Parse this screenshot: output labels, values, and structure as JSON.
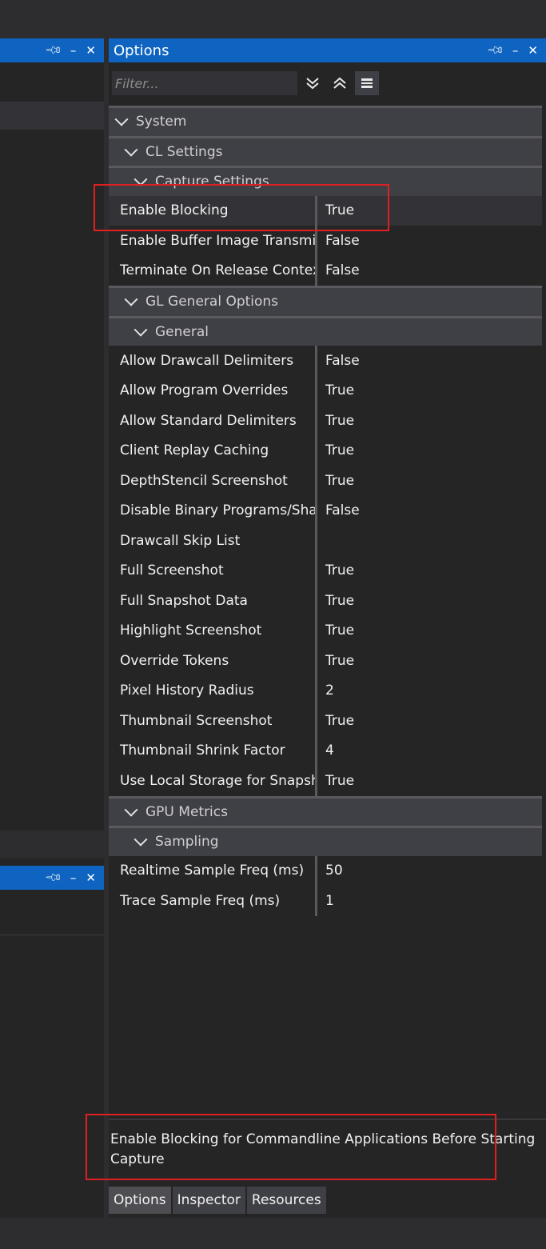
{
  "left_title_bar": {
    "icons": [
      "pin-icon",
      "minimize-icon",
      "close-icon"
    ]
  },
  "options": {
    "title": "Options",
    "filter_placeholder": "Filter...",
    "toolbar_icons": [
      "expand-all-icon",
      "collapse-all-icon",
      "categorize-icon"
    ]
  },
  "grid": {
    "system": "System",
    "cl_settings": "CL Settings",
    "capture_settings": "Capture Settings",
    "cl_rows": [
      {
        "name": "Enable Blocking",
        "value": "True"
      },
      {
        "name": "Enable Buffer Image Transmis",
        "value": "False"
      },
      {
        "name": "Terminate On Release Contex",
        "value": "False"
      }
    ],
    "gl_general_options": "GL General Options",
    "general": "General",
    "gl_rows": [
      {
        "name": "Allow Drawcall Delimiters",
        "value": "False"
      },
      {
        "name": "Allow Program Overrides",
        "value": "True"
      },
      {
        "name": "Allow Standard Delimiters",
        "value": "True"
      },
      {
        "name": "Client Replay Caching",
        "value": "True"
      },
      {
        "name": "DepthStencil Screenshot",
        "value": "True"
      },
      {
        "name": "Disable Binary Programs/Shad",
        "value": "False"
      },
      {
        "name": "Drawcall Skip List",
        "value": ""
      },
      {
        "name": "Full Screenshot",
        "value": "True"
      },
      {
        "name": "Full Snapshot Data",
        "value": "True"
      },
      {
        "name": "Highlight Screenshot",
        "value": "True"
      },
      {
        "name": "Override Tokens",
        "value": "True"
      },
      {
        "name": "Pixel History Radius",
        "value": "2"
      },
      {
        "name": "Thumbnail Screenshot",
        "value": "True"
      },
      {
        "name": "Thumbnail Shrink Factor",
        "value": "4"
      },
      {
        "name": "Use Local Storage for Snapsh",
        "value": "True"
      }
    ],
    "gpu_metrics": "GPU Metrics",
    "sampling": "Sampling",
    "gpu_rows": [
      {
        "name": "Realtime Sample Freq (ms)",
        "value": "50"
      },
      {
        "name": "Trace Sample Freq (ms)",
        "value": "1"
      }
    ]
  },
  "description": "Enable Blocking for Commandline Applications Before Starting Capture",
  "tabs": [
    "Options",
    "Inspector",
    "Resources"
  ],
  "colors": {
    "accent": "#0e64c0",
    "highlight": "#e02020"
  }
}
